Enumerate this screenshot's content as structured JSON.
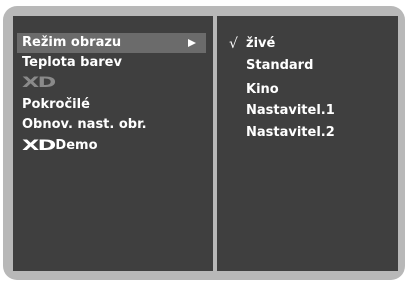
{
  "picture_menu": {
    "items": [
      {
        "label": "Režim obrazu",
        "selected": true,
        "has_submenu": true
      },
      {
        "label": "Teplota barev"
      },
      {
        "logo": "XD"
      },
      {
        "label": "Pokročilé"
      },
      {
        "label": "Obnov. nast. obr."
      },
      {
        "logo": "XD",
        "label": "Demo"
      }
    ]
  },
  "picture_mode_submenu": {
    "check_glyph": "√",
    "options": [
      {
        "label": "živé",
        "checked": true
      },
      {
        "label": "Standard"
      },
      {
        "label": "Kino"
      },
      {
        "label": "Nastavitel.1"
      },
      {
        "label": "Nastavitel.2"
      }
    ]
  },
  "colors": {
    "frame": "#b8b8b8",
    "panel": "#3f3f3f",
    "highlight": "#6b6b6b",
    "text": "#ffffff",
    "disabled_logo": "#8a8a8a"
  },
  "icons": {
    "submenu_arrow": "arrow-right-icon",
    "check": "check-mark-icon",
    "xd_logo": "xd-logo"
  }
}
